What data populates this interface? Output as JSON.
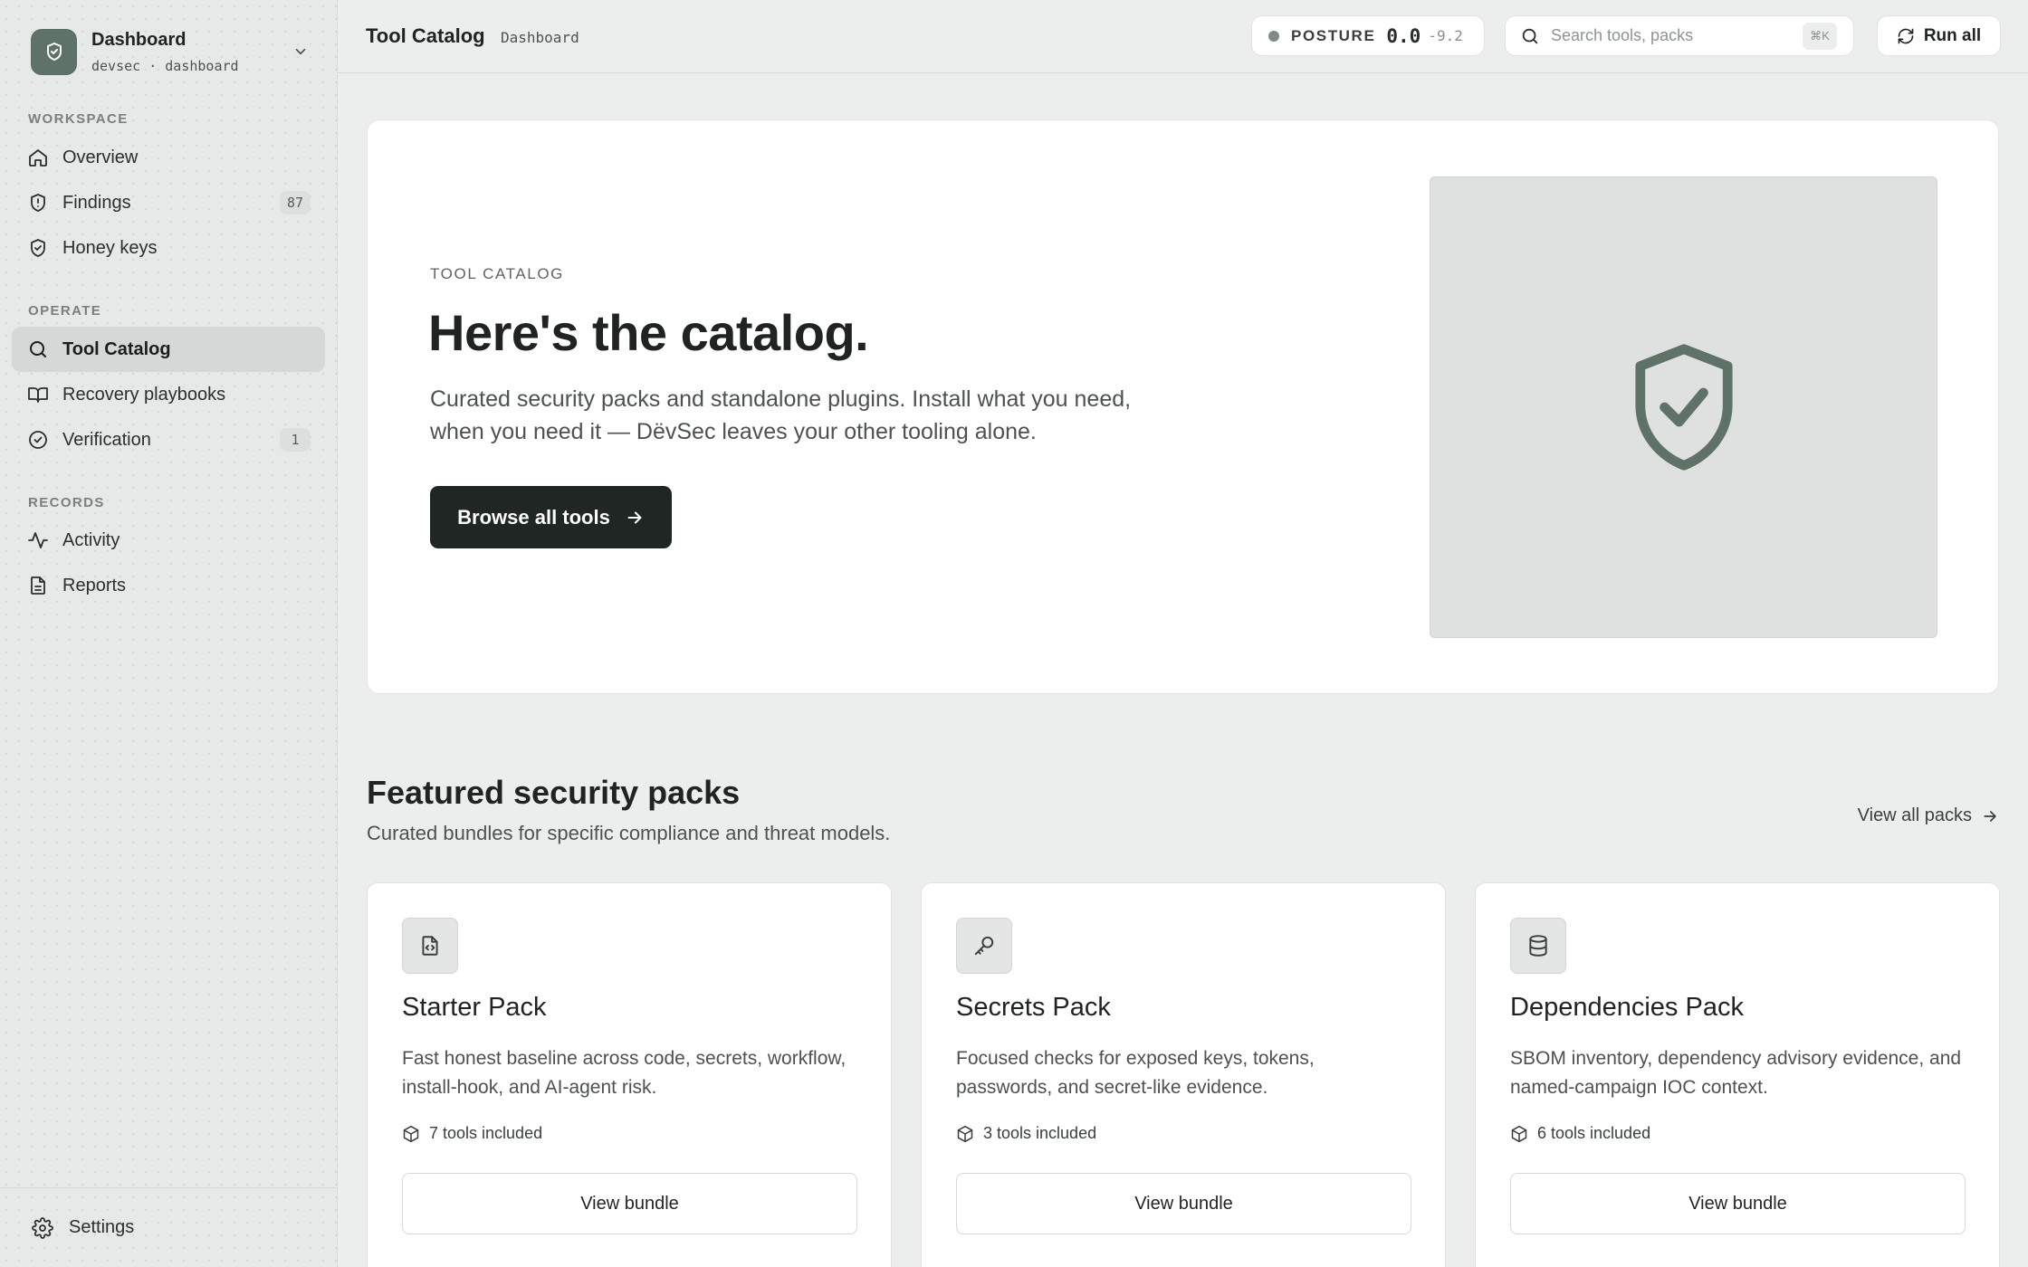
{
  "sidebar": {
    "brand": {
      "title": "Dashboard",
      "subtitle": "devsec · dashboard",
      "logo_icon": "shield-check-icon"
    },
    "sections": [
      {
        "label": "WORKSPACE"
      },
      {
        "label": "OPERATE"
      },
      {
        "label": "RECORDS"
      }
    ],
    "items": [
      {
        "label": "Overview",
        "icon": "home-icon"
      },
      {
        "label": "Findings",
        "icon": "shield-alert-icon",
        "badge": "87"
      },
      {
        "label": "Honey keys",
        "icon": "shield-check-icon"
      },
      {
        "label": "Tool Catalog",
        "icon": "search-icon",
        "active": true
      },
      {
        "label": "Recovery playbooks",
        "icon": "book-icon"
      },
      {
        "label": "Verification",
        "icon": "check-circle-icon",
        "badge": "1"
      },
      {
        "label": "Activity",
        "icon": "activity-icon"
      },
      {
        "label": "Reports",
        "icon": "document-icon"
      }
    ],
    "footer": {
      "label": "Settings",
      "icon": "gear-icon"
    }
  },
  "topbar": {
    "title": "Tool Catalog",
    "subtitle": "Dashboard",
    "posture": {
      "label": "POSTURE",
      "score": "0.0",
      "delta": "-9.2"
    },
    "search": {
      "placeholder": "Search tools, packs",
      "shortcut": "⌘K"
    },
    "run_all": "Run all"
  },
  "hero": {
    "eyebrow": "TOOL CATALOG",
    "title": "Here's the catalog.",
    "description": "Curated security packs and standalone plugins. Install what you need, when you need it — DëvSec leaves your other tooling alone.",
    "button": "Browse all tools"
  },
  "featured": {
    "title": "Featured security packs",
    "subtitle": "Curated bundles for specific compliance and threat models.",
    "view_all": "View all packs",
    "packs": [
      {
        "title": "Starter Pack",
        "icon": "file-code-icon",
        "description": "Fast honest baseline across code, secrets, workflow, install-hook, and AI-agent risk.",
        "meta": "7 tools included",
        "button": "View bundle"
      },
      {
        "title": "Secrets Pack",
        "icon": "key-icon",
        "description": "Focused checks for exposed keys, tokens, passwords, and secret-like evidence.",
        "meta": "3 tools included",
        "button": "View bundle"
      },
      {
        "title": "Dependencies Pack",
        "icon": "database-icon",
        "description": "SBOM inventory, dependency advisory evidence, and named-campaign IOC context.",
        "meta": "6 tools included",
        "button": "View bundle"
      }
    ]
  },
  "colors": {
    "accent": "#5f7268",
    "primary_button": "#1f2623",
    "background": "#eceeed"
  }
}
